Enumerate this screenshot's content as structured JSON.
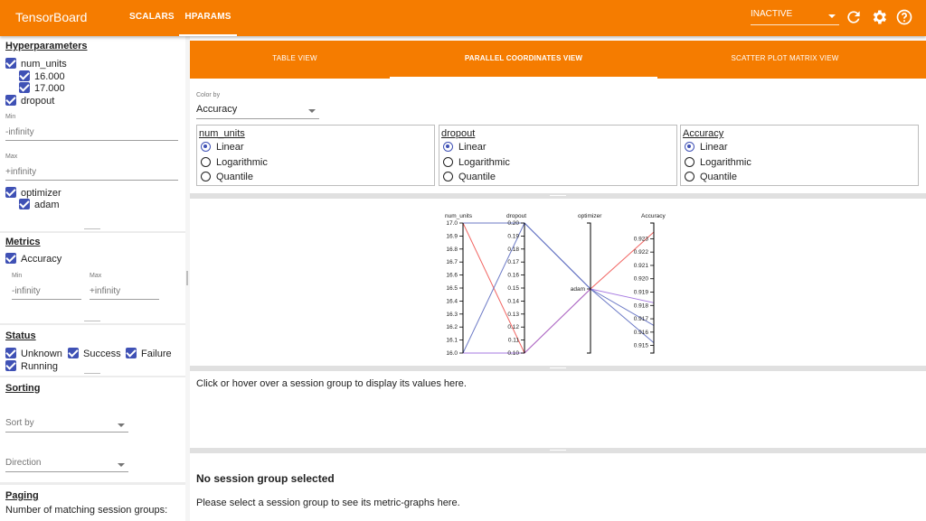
{
  "app": {
    "title": "TensorBoard"
  },
  "nav": {
    "tabs": [
      {
        "label": "SCALARS"
      },
      {
        "label": "HPARAMS"
      }
    ]
  },
  "status_selector": {
    "value": "INACTIVE"
  },
  "toolbar_icons": [
    "refresh-icon",
    "settings-icon",
    "help-icon"
  ],
  "colors": {
    "accent": "#f57c00",
    "checkbox": "#3f51b5",
    "line_red": "#ef5350",
    "line_blue": "#5c6bc0",
    "line_purple": "#9c6ade"
  },
  "sidebar": {
    "hyperparameters": {
      "title": "Hyperparameters",
      "num_units": {
        "label": "num_units",
        "values": [
          "16.000",
          "17.000"
        ]
      },
      "dropout": {
        "label": "dropout",
        "min_label": "Min",
        "min_value": "-infinity",
        "max_label": "Max",
        "max_value": "+infinity"
      },
      "optimizer": {
        "label": "optimizer",
        "values": [
          "adam"
        ]
      }
    },
    "metrics": {
      "title": "Metrics",
      "accuracy": {
        "label": "Accuracy",
        "min_label": "Min",
        "min_value": "-infinity",
        "max_label": "Max",
        "max_value": "+infinity"
      }
    },
    "status": {
      "title": "Status",
      "options": [
        "Unknown",
        "Success",
        "Failure",
        "Running"
      ]
    },
    "sorting": {
      "title": "Sorting",
      "sort_by": "Sort by",
      "direction": "Direction"
    },
    "paging": {
      "title": "Paging",
      "text": "Number of matching session groups:"
    }
  },
  "view_tabs": [
    {
      "label": "TABLE VIEW"
    },
    {
      "label": "PARALLEL COORDINATES VIEW"
    },
    {
      "label": "SCATTER PLOT MATRIX VIEW"
    }
  ],
  "color_by": {
    "label": "Color by",
    "value": "Accuracy"
  },
  "scales": {
    "options": [
      "Linear",
      "Logarithmic",
      "Quantile"
    ],
    "columns": [
      {
        "name": "num_units",
        "selected": "Linear"
      },
      {
        "name": "dropout",
        "selected": "Linear"
      },
      {
        "name": "Accuracy",
        "selected": "Linear"
      }
    ]
  },
  "parallel_coords": {
    "axes": [
      {
        "name": "num_units",
        "ticks": [
          "17.0",
          "16.9",
          "16.8",
          "16.7",
          "16.6",
          "16.5",
          "16.4",
          "16.3",
          "16.2",
          "16.1",
          "16.0"
        ],
        "range": [
          16.0,
          17.0
        ]
      },
      {
        "name": "dropout",
        "ticks": [
          "0.20",
          "0.19",
          "0.18",
          "0.17",
          "0.16",
          "0.15",
          "0.14",
          "0.13",
          "0.12",
          "0.11",
          "0.10"
        ],
        "range": [
          0.1,
          0.2
        ]
      },
      {
        "name": "optimizer",
        "ticks": [
          "adam"
        ]
      },
      {
        "name": "Accuracy",
        "ticks": [
          "0.923",
          "0.922",
          "0.921",
          "0.920",
          "0.919",
          "0.918",
          "0.917",
          "0.916",
          "0.915"
        ],
        "range": [
          0.9145,
          0.9235
        ]
      }
    ],
    "lines": [
      {
        "num_units": 17.0,
        "dropout": 0.1,
        "optimizer": "adam",
        "accuracy": 0.9235,
        "color": "#ef5350"
      },
      {
        "num_units": 16.0,
        "dropout": 0.2,
        "optimizer": "adam",
        "accuracy": 0.9165,
        "color": "#5c6bc0"
      },
      {
        "num_units": 17.0,
        "dropout": 0.2,
        "optimizer": "adam",
        "accuracy": 0.9152,
        "color": "#5c6bc0"
      },
      {
        "num_units": 16.0,
        "dropout": 0.1,
        "optimizer": "adam",
        "accuracy": 0.9182,
        "color": "#9c6ade"
      }
    ]
  },
  "session_info": {
    "text": "Click or hover over a session group to display its values here."
  },
  "metric_graphs": {
    "title": "No session group selected",
    "text": "Please select a session group to see its metric-graphs here."
  }
}
